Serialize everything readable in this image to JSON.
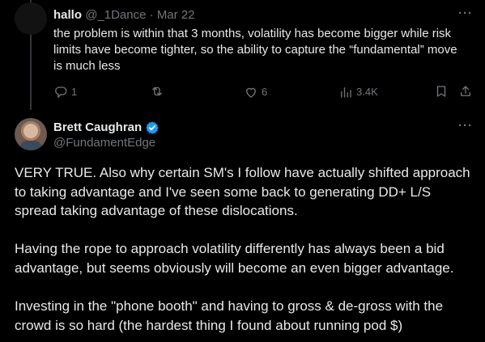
{
  "reply": {
    "name": "hallo",
    "handle": "@_1Dance",
    "separator": "·",
    "date": "Mar 22",
    "more": "···",
    "text": "the problem is within that 3 months, volatility has become bigger while risk limits have become tighter, so the ability to capture the “fundamental” move is much less",
    "actions": {
      "reply_icon": "reply-icon",
      "reply_count": "1",
      "retweet_icon": "retweet-icon",
      "like_icon": "heart-icon",
      "like_count": "6",
      "views_icon": "views-icon",
      "views_count": "3.4K",
      "bookmark_icon": "bookmark-icon",
      "share_icon": "share-icon"
    }
  },
  "tweet": {
    "name": "Brett Caughran",
    "verified_color": "#1d9bf0",
    "handle": "@FundamentEdge",
    "more": "···",
    "paragraphs": [
      "VERY TRUE. Also why certain SM's I follow have actually shifted approach to taking advantage and I've seen some back to generating DD+ L/S spread taking advantage of these dislocations.",
      "Having the rope to approach volatility differently has always been a bid advantage, but seems obviously will become an even bigger advantage.",
      "Investing in the \"phone booth\" and having to gross & de-gross with the crowd is so hard (the hardest thing I found about running pod $)"
    ]
  },
  "colors": {
    "background": "#000000",
    "text": "#e7e9ea",
    "muted": "#71767b",
    "accent": "#1d9bf0"
  }
}
